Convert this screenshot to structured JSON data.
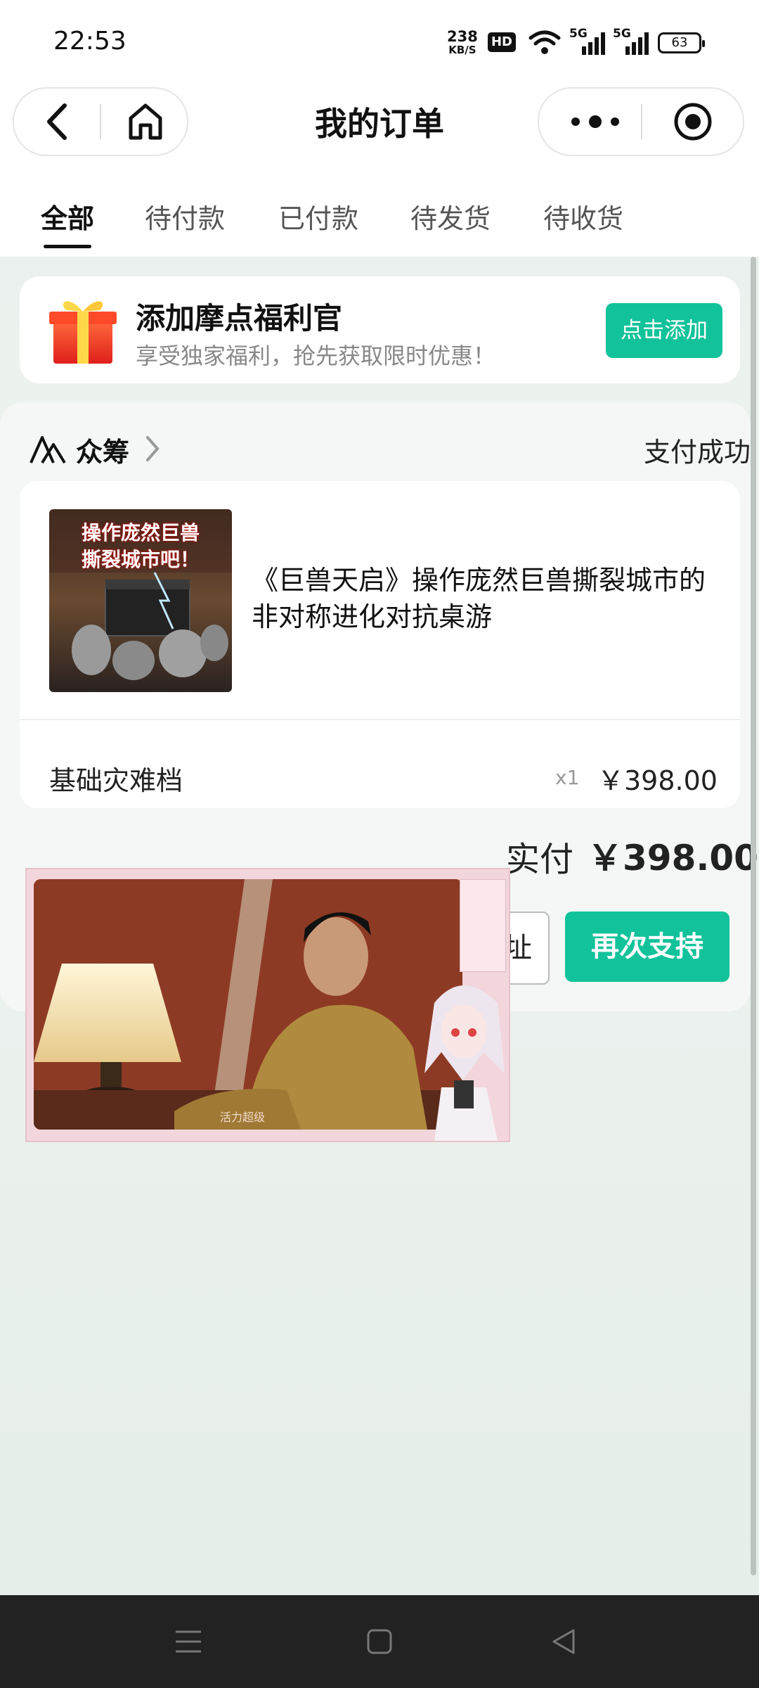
{
  "status_bar": {
    "time": "22:53",
    "net_speed_value": "238",
    "net_speed_unit": "KB/S",
    "hd_label": "HD",
    "signal1_label": "5G",
    "signal2_label": "5G",
    "battery": "63"
  },
  "header": {
    "title": "我的订单"
  },
  "tabs": [
    {
      "label": "全部",
      "active": true
    },
    {
      "label": "待付款"
    },
    {
      "label": "已付款"
    },
    {
      "label": "待发货"
    },
    {
      "label": "待收货"
    }
  ],
  "welfare": {
    "title": "添加摩点福利官",
    "subtitle": "享受独家福利，抢先获取限时优惠！",
    "button": "点击添加"
  },
  "order": {
    "shop": "众筹",
    "status": "支付成功",
    "product_title": "《巨兽天启》操作庞然巨兽撕裂城市的非对称进化对抗桌游",
    "product_image_text_line1": "操作庞然巨兽",
    "product_image_text_line2": "撕裂城市吧！",
    "sku": "基础灾难档",
    "quantity": "x1",
    "price": "￥398.00",
    "paid_label": "实付",
    "paid_amount": "￥398.00",
    "address_button_partial": "址",
    "again_button": "再次支持"
  },
  "video": {
    "caption": "活力超级"
  },
  "colors": {
    "accent": "#12c29a",
    "navbar": "#222222"
  }
}
